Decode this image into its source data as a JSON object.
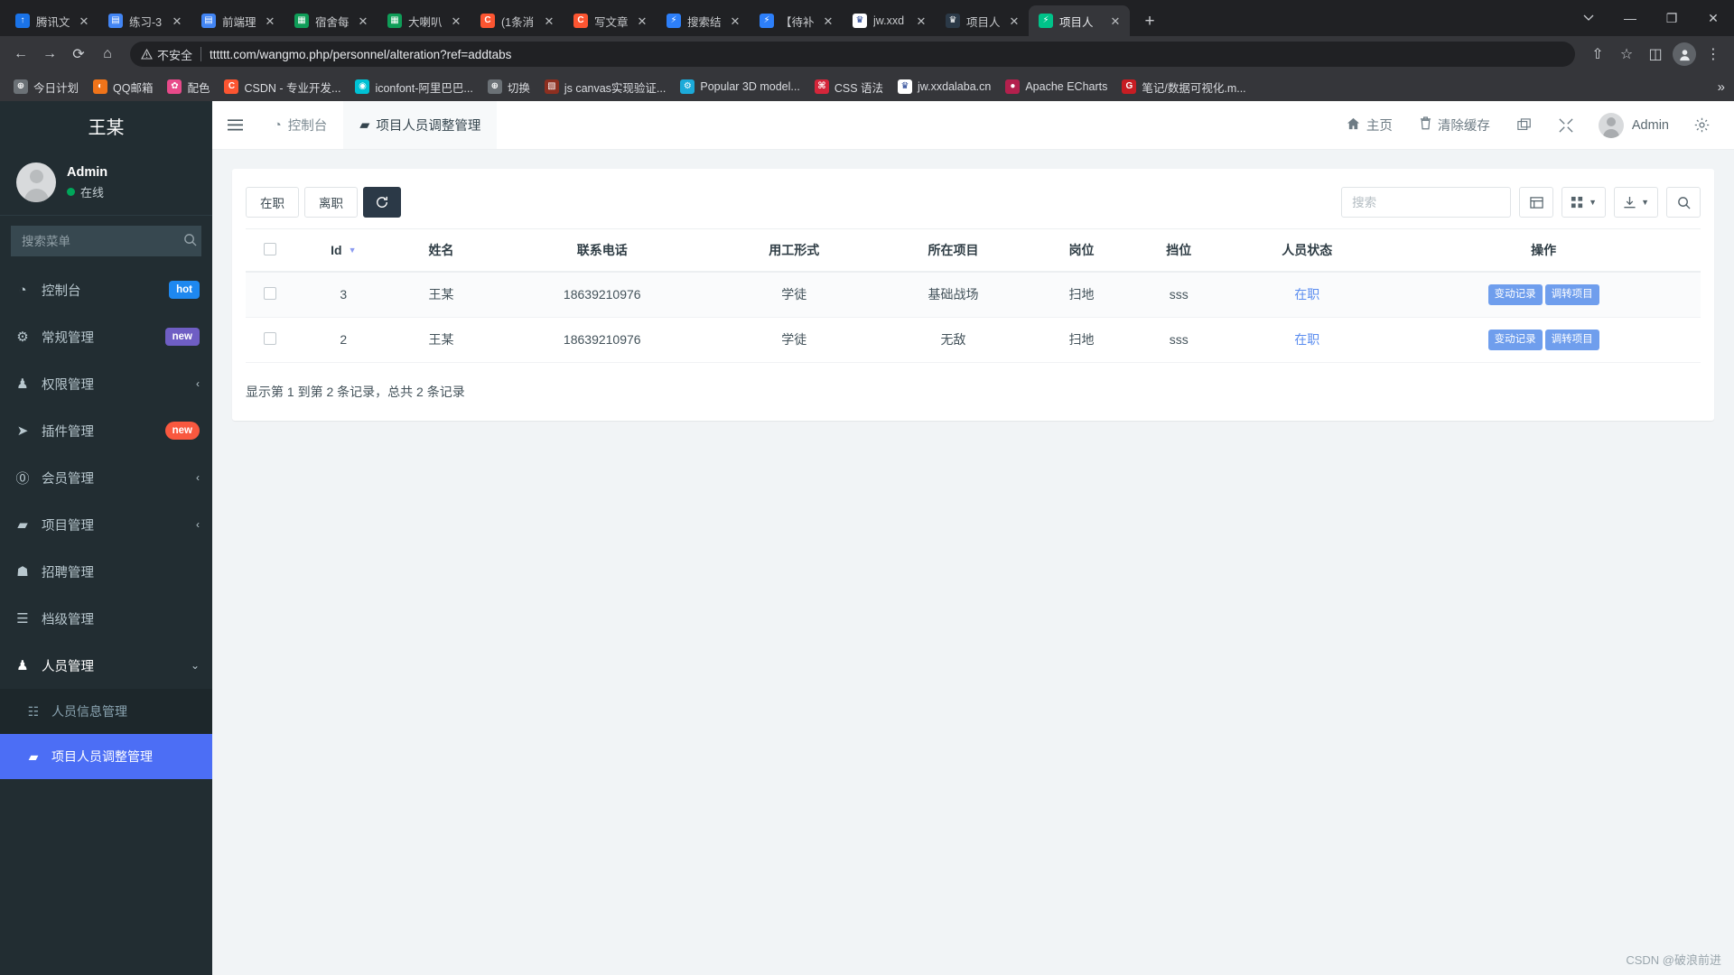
{
  "browser": {
    "tabs": [
      {
        "title": "腾讯文",
        "favicon": "tencent-docs-icon",
        "color": "#1a73e8",
        "glyph": "↑",
        "active": false
      },
      {
        "title": "练习-3",
        "favicon": "google-docs-icon",
        "color": "#4285f4",
        "glyph": "▤",
        "active": false
      },
      {
        "title": "前端理",
        "favicon": "google-docs-icon",
        "color": "#4285f4",
        "glyph": "▤",
        "active": false
      },
      {
        "title": "宿舍每",
        "favicon": "google-sheets-icon",
        "color": "#0f9d58",
        "glyph": "▦",
        "active": false
      },
      {
        "title": "大喇叭",
        "favicon": "google-sheets-icon",
        "color": "#0f9d58",
        "glyph": "▦",
        "active": false
      },
      {
        "title": "(1条消",
        "favicon": "csdn-icon",
        "color": "#fc5531",
        "glyph": "C",
        "active": false
      },
      {
        "title": "写文章",
        "favicon": "csdn-icon",
        "color": "#fc5531",
        "glyph": "C",
        "active": false
      },
      {
        "title": "搜索结",
        "favicon": "bolt-icon",
        "color": "#2d7ff9",
        "glyph": "⚡",
        "active": false
      },
      {
        "title": "【待补",
        "favicon": "bolt-icon",
        "color": "#2d7ff9",
        "glyph": "⚡",
        "active": false
      },
      {
        "title": "jw.xxd",
        "favicon": "school-crest-icon",
        "color": "#ffffff",
        "glyph": "♛",
        "active": false
      },
      {
        "title": "项目人",
        "favicon": "school-crest-icon",
        "color": "#2b3947",
        "glyph": "♛",
        "active": false
      },
      {
        "title": "项目人",
        "favicon": "shield-green-icon",
        "color": "#00c389",
        "glyph": "⚡",
        "active": true
      }
    ],
    "new_tab_label": "+",
    "window_controls": {
      "tab_search": "tab-search-chevron",
      "minimize": "—",
      "maximize": "❐",
      "close": "✕"
    },
    "toolbar": {
      "back": "←",
      "forward": "→",
      "reload": "⟳",
      "home": "⌂",
      "security_label": "不安全",
      "url": "tttttt.com/wangmo.php/personnel/alteration?ref=addtabs",
      "share": "⇧",
      "bookmark_star": "☆",
      "split": "◫",
      "profile": "●",
      "menu": "⋮"
    },
    "bookmarks": [
      {
        "label": "今日计划",
        "icon": "globe-icon",
        "color": "#6b7176",
        "glyph": "⊕"
      },
      {
        "label": "QQ邮箱",
        "icon": "qq-mail-icon",
        "color": "#f0741a",
        "glyph": "◐"
      },
      {
        "label": "配色",
        "icon": "flower-icon",
        "color": "#e84a8a",
        "glyph": "✿"
      },
      {
        "label": "CSDN - 专业开发...",
        "icon": "csdn-icon",
        "color": "#fc5531",
        "glyph": "C"
      },
      {
        "label": "iconfont-阿里巴巴...",
        "icon": "iconfont-icon",
        "color": "#00c1d4",
        "glyph": "◉"
      },
      {
        "label": "切换",
        "icon": "globe-icon",
        "color": "#6b7176",
        "glyph": "⊕"
      },
      {
        "label": "js canvas实现验证...",
        "icon": "js-book-icon",
        "color": "#8d2f20",
        "glyph": "▧"
      },
      {
        "label": "Popular 3D model...",
        "icon": "sketchfab-icon",
        "color": "#1caad9",
        "glyph": "⚙"
      },
      {
        "label": "CSS 语法",
        "icon": "css-icon",
        "color": "#d4263a",
        "glyph": "⌘"
      },
      {
        "label": "jw.xxdalaba.cn",
        "icon": "school-crest-icon",
        "color": "#ffffff",
        "glyph": "♛"
      },
      {
        "label": "Apache ECharts",
        "icon": "echarts-icon",
        "color": "#b3204d",
        "glyph": "●"
      },
      {
        "label": "笔记/数据可视化.m...",
        "icon": "gitee-icon",
        "color": "#c71d23",
        "glyph": "G"
      }
    ],
    "bookmarks_overflow": "»"
  },
  "sidebar": {
    "logo": "王某",
    "user": {
      "name": "Admin",
      "status": "在线"
    },
    "search": {
      "placeholder": "搜索菜单",
      "value": "",
      "icon": "search-icon"
    },
    "items": [
      {
        "label": "控制台",
        "icon": "dashboard-icon",
        "glyph": "◔",
        "badge": "hot",
        "badge_color": "#1e88f0",
        "badge_round": false,
        "caret": ""
      },
      {
        "label": "常规管理",
        "icon": "gears-icon",
        "glyph": "⚙",
        "badge": "new",
        "badge_color": "#6f5ec4",
        "badge_round": false,
        "caret": ""
      },
      {
        "label": "权限管理",
        "icon": "users-icon",
        "glyph": "♟",
        "badge": "",
        "badge_color": "",
        "badge_round": false,
        "caret": "‹"
      },
      {
        "label": "插件管理",
        "icon": "rocket-icon",
        "glyph": "➤",
        "badge": "new",
        "badge_color": "#f9583f",
        "badge_round": true,
        "caret": ""
      },
      {
        "label": "会员管理",
        "icon": "user-circle-icon",
        "glyph": "⓪",
        "badge": "",
        "badge_color": "",
        "badge_round": false,
        "caret": "‹"
      },
      {
        "label": "项目管理",
        "icon": "folder-icon",
        "glyph": "▰",
        "badge": "",
        "badge_color": "",
        "badge_round": false,
        "caret": "‹"
      },
      {
        "label": "招聘管理",
        "icon": "graduation-cap-icon",
        "glyph": "☗",
        "badge": "",
        "badge_color": "",
        "badge_round": false,
        "caret": ""
      },
      {
        "label": "档级管理",
        "icon": "file-text-icon",
        "glyph": "☰",
        "badge": "",
        "badge_color": "",
        "badge_round": false,
        "caret": ""
      },
      {
        "label": "人员管理",
        "icon": "person-icon",
        "glyph": "♟",
        "badge": "",
        "badge_color": "",
        "badge_round": false,
        "caret": "⌄",
        "open": true
      }
    ],
    "subitems": [
      {
        "label": "人员信息管理",
        "icon": "building-icon",
        "glyph": "☷",
        "active": false
      },
      {
        "label": "项目人员调整管理",
        "icon": "briefcase-icon",
        "glyph": "▰",
        "active": true
      }
    ]
  },
  "navbar": {
    "toggle_icon": "hamburger-icon",
    "tabs": [
      {
        "label": "控制台",
        "icon": "dashboard-icon",
        "glyph": "◔",
        "active": false
      },
      {
        "label": "项目人员调整管理",
        "icon": "briefcase-icon",
        "glyph": "▰",
        "active": true
      }
    ],
    "links": [
      {
        "label": "主页",
        "icon": "home-icon",
        "glyph": "⌂"
      },
      {
        "label": "清除缓存",
        "icon": "trash-icon",
        "glyph": "Ὕ1"
      }
    ],
    "icon_buttons": [
      {
        "name": "multi-screen-icon",
        "glyph": "⧉"
      },
      {
        "name": "fullscreen-icon",
        "glyph": "⤢"
      }
    ],
    "user": "Admin",
    "settings_icon": "gear-icon"
  },
  "toolbar": {
    "filters": [
      {
        "label": "在职",
        "active": false
      },
      {
        "label": "离职",
        "active": false
      }
    ],
    "refresh_icon": "refresh-icon",
    "search": {
      "placeholder": "搜索",
      "value": ""
    },
    "right_buttons": [
      {
        "name": "toggle-view-button",
        "glyph": "▤",
        "caret": false
      },
      {
        "name": "columns-button",
        "glyph": "☷",
        "caret": true
      },
      {
        "name": "export-button",
        "glyph": "⤓",
        "caret": true
      },
      {
        "name": "search-button",
        "glyph": "⌕",
        "caret": false
      }
    ]
  },
  "table": {
    "select_all": "select-all-checkbox",
    "columns": [
      {
        "label": "",
        "key": "checkbox"
      },
      {
        "label": "Id",
        "key": "id",
        "sorted": true,
        "sort_dir": "desc"
      },
      {
        "label": "姓名",
        "key": "name"
      },
      {
        "label": "联系电话",
        "key": "phone"
      },
      {
        "label": "用工形式",
        "key": "employment"
      },
      {
        "label": "所在项目",
        "key": "project"
      },
      {
        "label": "岗位",
        "key": "post"
      },
      {
        "label": "挡位",
        "key": "grade"
      },
      {
        "label": "人员状态",
        "key": "status"
      },
      {
        "label": "操作",
        "key": "actions"
      }
    ],
    "rows": [
      {
        "id": "3",
        "name": "王某",
        "phone": "18639210976",
        "employment": "学徒",
        "project": "基础战场",
        "post": "扫地",
        "grade": "sss",
        "status": "在职",
        "actions": [
          "变动记录",
          "调转项目"
        ]
      },
      {
        "id": "2",
        "name": "王某",
        "phone": "18639210976",
        "employment": "学徒",
        "project": "无敌",
        "post": "扫地",
        "grade": "sss",
        "status": "在职",
        "actions": [
          "变动记录",
          "调转项目"
        ]
      }
    ],
    "pagination_text": "显示第 1 到第 2 条记录，总共 2 条记录"
  },
  "watermark": "CSDN @破浪前进",
  "colors": {
    "sidebar_bg": "#222d32",
    "active_menu": "#4c6ef5",
    "accent": "#6f9eed",
    "badge_hot": "#1e88f0",
    "badge_new_purple": "#6f5ec4",
    "badge_new_red": "#f9583f",
    "online_green": "#00a65a"
  }
}
